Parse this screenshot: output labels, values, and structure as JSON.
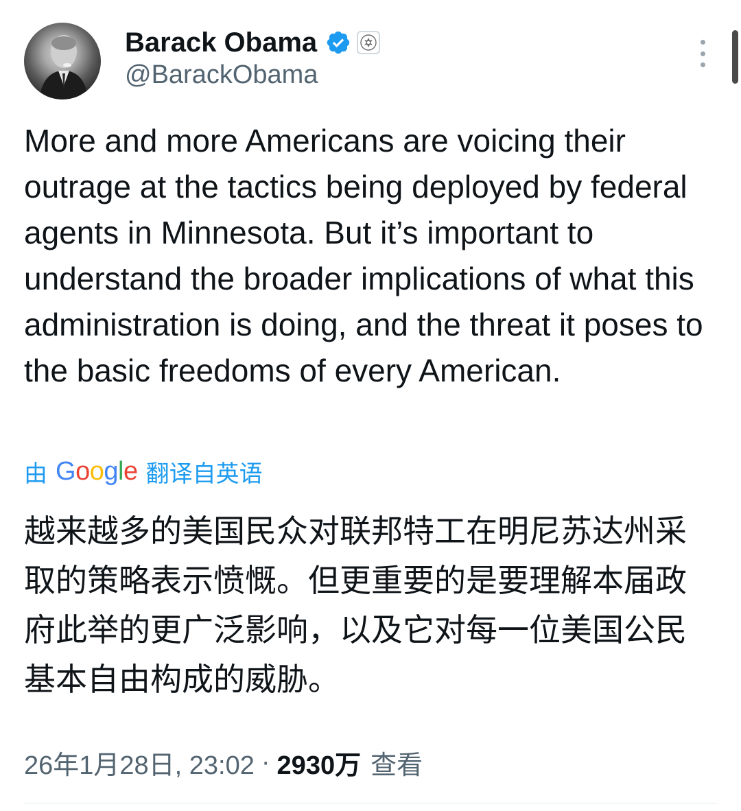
{
  "author": {
    "name": "Barack Obama",
    "handle": "@BarackObama"
  },
  "tweet": {
    "text": "More and more Americans are voicing their outrage at the tactics being deployed by federal agents in Minnesota. But it’s important to understand the broader implications of what this administration is doing, and the threat it poses to the basic freedoms of every American.",
    "translation_prefix": "由",
    "translation_provider": "Google",
    "translation_suffix": "翻译自英语",
    "translated_text": "越来越多的美国民众对联邦特工在明尼苏达州采取的策略表示愤慨。但更重要的是要理解本届政府此举的更广泛影响，以及它对每一位美国公民基本自由构成的威胁。"
  },
  "meta": {
    "timestamp": "26年1月28日, 23:02",
    "separator": "·",
    "views_count": "2930万",
    "views_label": "查看"
  },
  "icons": {
    "verified": "verified-badge-icon",
    "affiliate": "presidential-seal-icon",
    "more": "more-options-icon"
  },
  "colors": {
    "link": "#1d9bf0",
    "secondary_text": "#536471",
    "primary_text": "#0f1419"
  }
}
